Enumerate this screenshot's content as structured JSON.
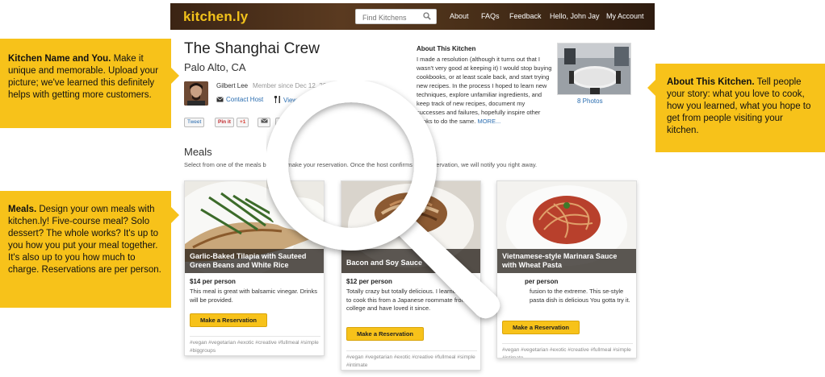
{
  "nav": {
    "logo": "kitchen.ly",
    "search_placeholder": "Find Kitchens",
    "about": "About",
    "faqs": "FAQs",
    "feedback": "Feedback",
    "greeting": "Hello, John Jay",
    "account": "My Account"
  },
  "callouts": {
    "kitchen_name": {
      "bold": "Kitchen Name and You.",
      "text": " Make it unique and memorable. Upload your picture; we've learned this definitely helps with getting more customers."
    },
    "about_kitchen": {
      "bold": "About This Kitchen.",
      "text": " Tell people your story: what you love to cook, how you learned, what you hope to get from people visiting your kitchen."
    },
    "meals": {
      "bold": "Meals.",
      "text": " Design your own meals with kitchen.ly! Five-course meal? Solo dessert? The whole works? It's up to you how you put your meal together. It's also up to you how much to charge. Reservations are per person."
    }
  },
  "kitchen": {
    "title": "The Shanghai Crew",
    "location": "Palo Alto, CA",
    "host_name": "Gilbert Lee",
    "member_since": "Member since Dec 12, 2012",
    "contact_host": "Contact Host",
    "view_reviews": "View Reviews"
  },
  "share": {
    "tweet": "Tweet",
    "pinit": "Pin it",
    "plus1": "+1",
    "like": "Like"
  },
  "about": {
    "title": "About This Kitchen",
    "text": "I made a resolution (although it turns out that I wasn't very good at keeping it) I would stop buying cookbooks, or at least scale back, and start trying new recipes. In the process I hoped to learn new techniques, explore unfamiliar ingredients, and keep track of new recipes, document my successes and failures, hopefully inspire other cooks to do the same.",
    "more": "MORE...",
    "photos": "8 Photos"
  },
  "meals": {
    "heading": "Meals",
    "subtext": "Select from one of the meals below to make your reservation. Once the host confirms your reservation, we will notify you right away.",
    "button": "Make a Reservation",
    "items": [
      {
        "title": "Garlic-Baked Tilapia with Sauteed Green Beans and White Rice",
        "price": "$14 per person",
        "desc": "This meal is great with balsamic vinegar. Drinks will be provided.",
        "tags": "#vegan #vegetarian #exotic #creative #fullmeal #simple #biggroups"
      },
      {
        "title": "Bacon and Soy Sauce",
        "price": "$12 per person",
        "desc": "Totally crazy but totally delicious. I learned how to cook this from a Japanese roommate from college and have loved it since.",
        "tags": "#vegan #vegetarian #exotic #creative #fullmeal #simple #intimate"
      },
      {
        "title": "Vietnamese-style Marinara Sauce with Wheat Pasta",
        "price": "per person",
        "desc": "fusion to the extreme. This se-style pasta dish is delicious You gotta try it.",
        "tags": "#vegan #vegetarian #exotic #creative #fullmeal #simple #intimate"
      }
    ]
  },
  "colors": {
    "accent": "#f7c21a",
    "link": "#2a6db0",
    "topbar": "#4a3019"
  }
}
